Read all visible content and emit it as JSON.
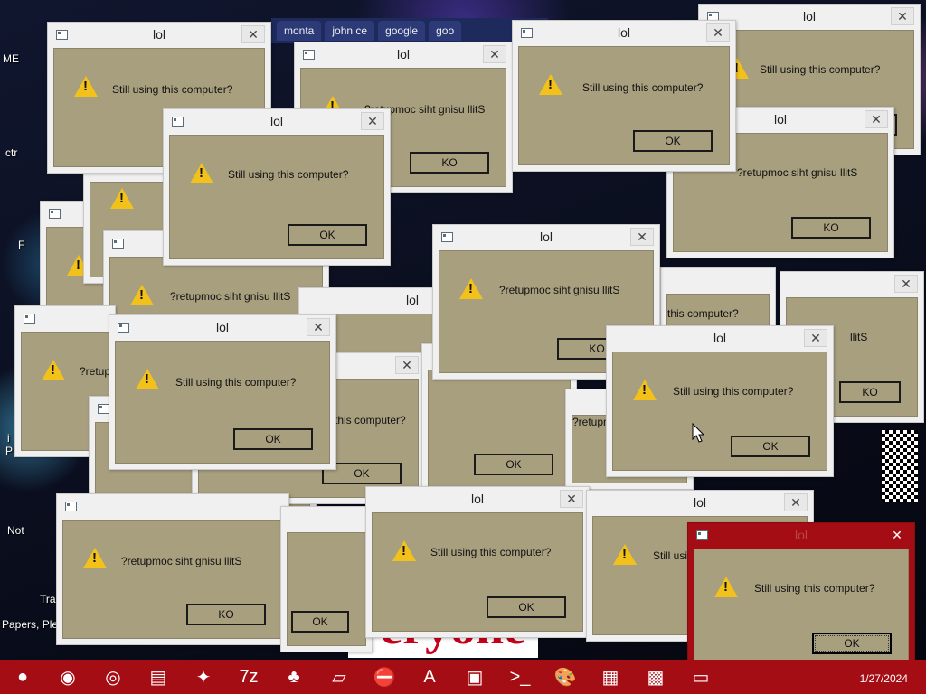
{
  "browser": {
    "tabs": [
      "monta",
      "john ce",
      "google",
      "goo"
    ]
  },
  "desktop_labels": {
    "me": "ME",
    "ctr": "ctr",
    "papers": "Papers, Plea",
    "not": "Not",
    "tra": "Tra",
    "p": "P",
    "fr": "F",
    "i": "i"
  },
  "poster_text": "Veryone",
  "dialog_title": "lol",
  "messages": {
    "normal": "Still using this computer?",
    "reversed": "?retupmoc siht gnisu llitS",
    "partial_reversed": "?retupmoc siht gnisu llitS",
    "partial_this": "this computer?",
    "partial_llits": "llitS"
  },
  "buttons": {
    "ok": "OK",
    "ko": "KO"
  },
  "close_glyph": "✕",
  "taskbar": {
    "date": "1/27/2024",
    "apps": [
      {
        "icon": "ornament-icon",
        "glyph": "●"
      },
      {
        "icon": "firefox-icon",
        "glyph": "◉"
      },
      {
        "icon": "chrome-icon",
        "glyph": "◎"
      },
      {
        "icon": "file-explorer-icon",
        "glyph": "▤"
      },
      {
        "icon": "star-app-icon",
        "glyph": "✦"
      },
      {
        "icon": "7zip-icon",
        "glyph": "7z"
      },
      {
        "icon": "chicken-icon",
        "glyph": "♣"
      },
      {
        "icon": "notepad-icon",
        "glyph": "▱"
      },
      {
        "icon": "do-not-disturb-icon",
        "glyph": "⛔"
      },
      {
        "icon": "wordpad-icon",
        "glyph": "A"
      },
      {
        "icon": "window-app-icon",
        "glyph": "▣"
      },
      {
        "icon": "terminal-icon",
        "glyph": ">_"
      },
      {
        "icon": "paint-icon",
        "glyph": "🎨"
      },
      {
        "icon": "calculator-icon",
        "glyph": "▦"
      },
      {
        "icon": "network-icon",
        "glyph": "▩"
      },
      {
        "icon": "drive-icon",
        "glyph": "▭"
      }
    ]
  },
  "colors": {
    "dialog_body": "#a89f7f",
    "active_frame": "#a50d14",
    "taskbar": "#a50d14"
  }
}
